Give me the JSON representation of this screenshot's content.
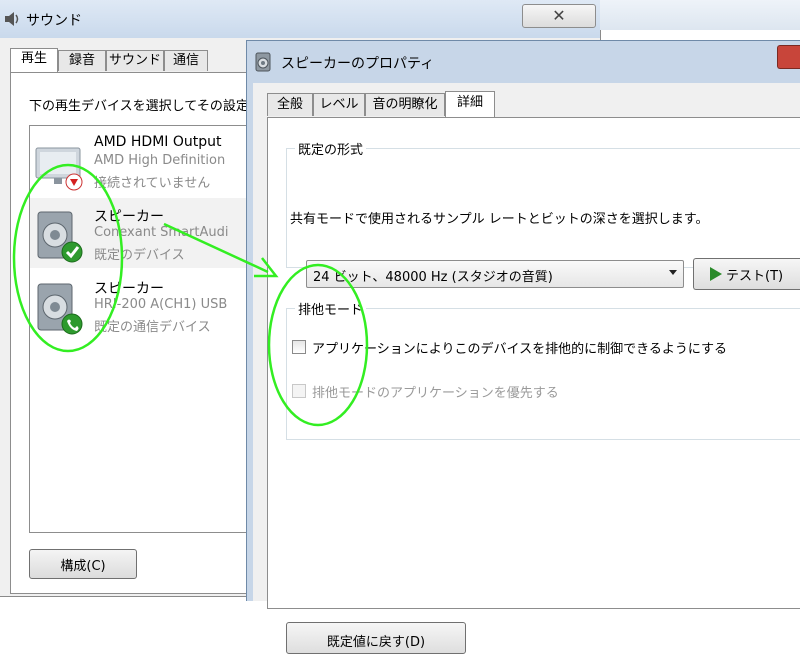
{
  "sound_window": {
    "title": "サウンド",
    "close_glyph": "✕",
    "tabs": [
      {
        "label": "再生"
      },
      {
        "label": "録音"
      },
      {
        "label": "サウンド"
      },
      {
        "label": "通信"
      }
    ],
    "instruction": "下の再生デバイスを選択してその設定",
    "devices": [
      {
        "name": "AMD HDMI Output",
        "sub": "AMD High Definition",
        "status": "接続されていません"
      },
      {
        "name": "スピーカー",
        "sub": "Conexant SmartAudi",
        "status": "既定のデバイス"
      },
      {
        "name": "スピーカー",
        "sub": "HRI-200 A(CH1) USB",
        "status": "既定の通信デバイス"
      }
    ],
    "configure_label": "構成(C)"
  },
  "props_window": {
    "title": "スピーカーのプロパティ",
    "tabs": [
      {
        "label": "全般"
      },
      {
        "label": "レベル"
      },
      {
        "label": "音の明瞭化"
      },
      {
        "label": "詳細"
      }
    ],
    "default_format": {
      "group_title": "既定の形式",
      "description": "共有モードで使用されるサンプル レートとビットの深さを選択します。",
      "selected": "24 ビット、48000 Hz (スタジオの音質)",
      "test_label": "テスト(T)"
    },
    "exclusive_mode": {
      "group_title": "排他モード",
      "option1": "アプリケーションによりこのデバイスを排他的に制御できるようにする",
      "option2": "排他モードのアプリケーションを優先する"
    },
    "restore_label": "既定値に戻す(D)"
  },
  "colors": {
    "annotation": "#33ee22",
    "selected_row": "#f2f2f2",
    "close_red": "#c8453a"
  }
}
